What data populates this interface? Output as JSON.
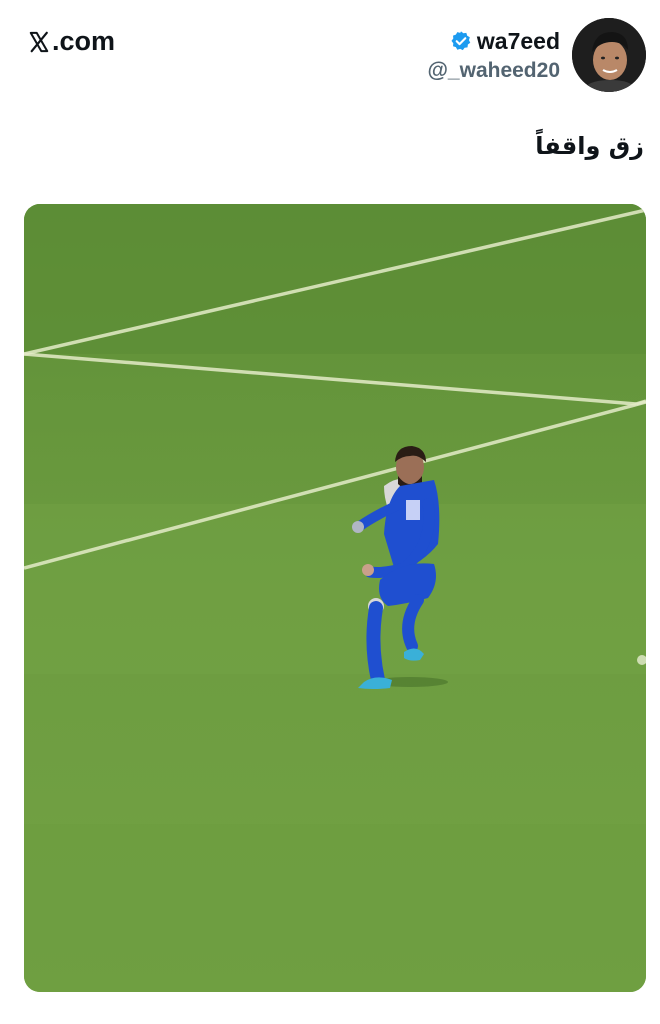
{
  "brand": {
    "label": ".com",
    "icon": "x-logo-icon"
  },
  "author": {
    "display_name": "wa7eed",
    "handle": "@_waheed20",
    "verified": true,
    "verified_color": "#1d9bf0",
    "badge_icon": "verified-badge-icon",
    "avatar_icon": "avatar-photo"
  },
  "tweet": {
    "text": "زق واقفاً"
  },
  "media": {
    "kind": "image",
    "colors": {
      "pitch": "#6a9a3e",
      "kit": "#1f4fd0"
    }
  }
}
